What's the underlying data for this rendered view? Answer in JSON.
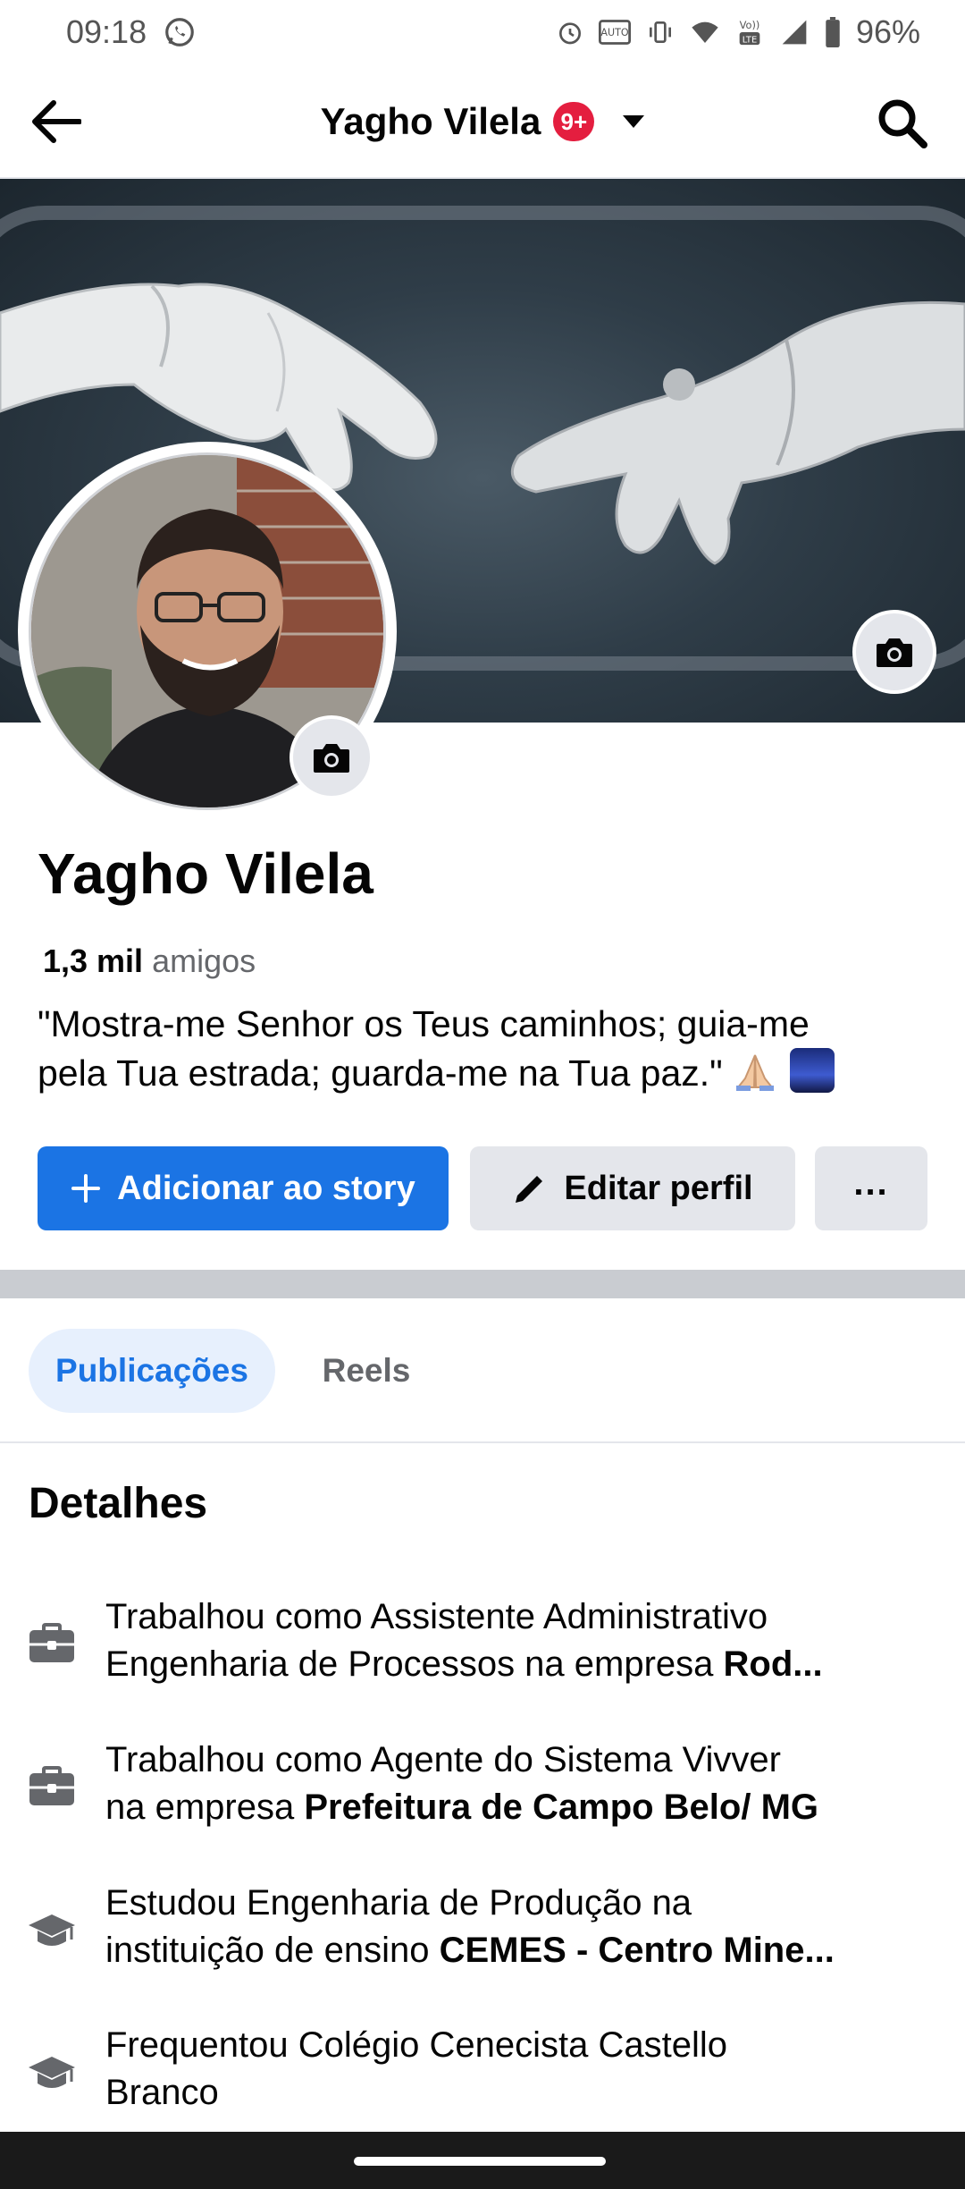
{
  "status_bar": {
    "time": "09:18",
    "battery": "96%",
    "icons": [
      "whatsapp-icon",
      "alarm-icon",
      "auto-hd-icon",
      "vibrate-icon",
      "wifi-icon",
      "volte-icon",
      "signal-icon",
      "battery-icon"
    ]
  },
  "app_bar": {
    "title": "Yagho Vilela",
    "badge": "9+",
    "icons": [
      "back-arrow-icon",
      "chevron-down-icon",
      "search-icon"
    ]
  },
  "profile": {
    "name": "Yagho Vilela",
    "friends_count": "1,3 mil",
    "friends_label": "amigos",
    "bio_line1": "\"Mostra-me Senhor os Teus caminhos; guia-me",
    "bio_line2": "pela Tua estrada; guarda-me na Tua paz.\"",
    "bio_emojis": [
      "praying-hands-emoji",
      "milky-way-emoji"
    ]
  },
  "actions": {
    "add_story": "Adicionar ao story",
    "edit_profile": "Editar perfil",
    "more": "..."
  },
  "tabs": [
    {
      "label": "Publicações",
      "active": true
    },
    {
      "label": "Reels",
      "active": false
    }
  ],
  "details": {
    "title": "Detalhes",
    "items": [
      {
        "icon": "briefcase-icon",
        "line1": "Trabalhou como Assistente Administrativo",
        "line2_prefix": "Engenharia de Processos na empresa ",
        "line2_bold": "Rod..."
      },
      {
        "icon": "briefcase-icon",
        "line1": "Trabalhou como Agente do Sistema Vivver",
        "line2_prefix": "na empresa ",
        "line2_bold": "Prefeitura de Campo Belo/ MG"
      },
      {
        "icon": "graduation-cap-icon",
        "line1": "Estudou Engenharia de Produção na",
        "line2_prefix": "instituição de ensino ",
        "line2_bold": "CEMES - Centro Mine..."
      },
      {
        "icon": "graduation-cap-icon",
        "line1": "Frequentou Colégio Cenecista Castello",
        "line2_prefix": "Branco",
        "line2_bold": ""
      }
    ]
  },
  "colors": {
    "primary_blue": "#1b74e4",
    "badge_red": "#e41e3f",
    "secondary_bg": "#e4e6eb",
    "tab_active_bg": "#e7f0fd",
    "muted_text": "#65676b"
  }
}
